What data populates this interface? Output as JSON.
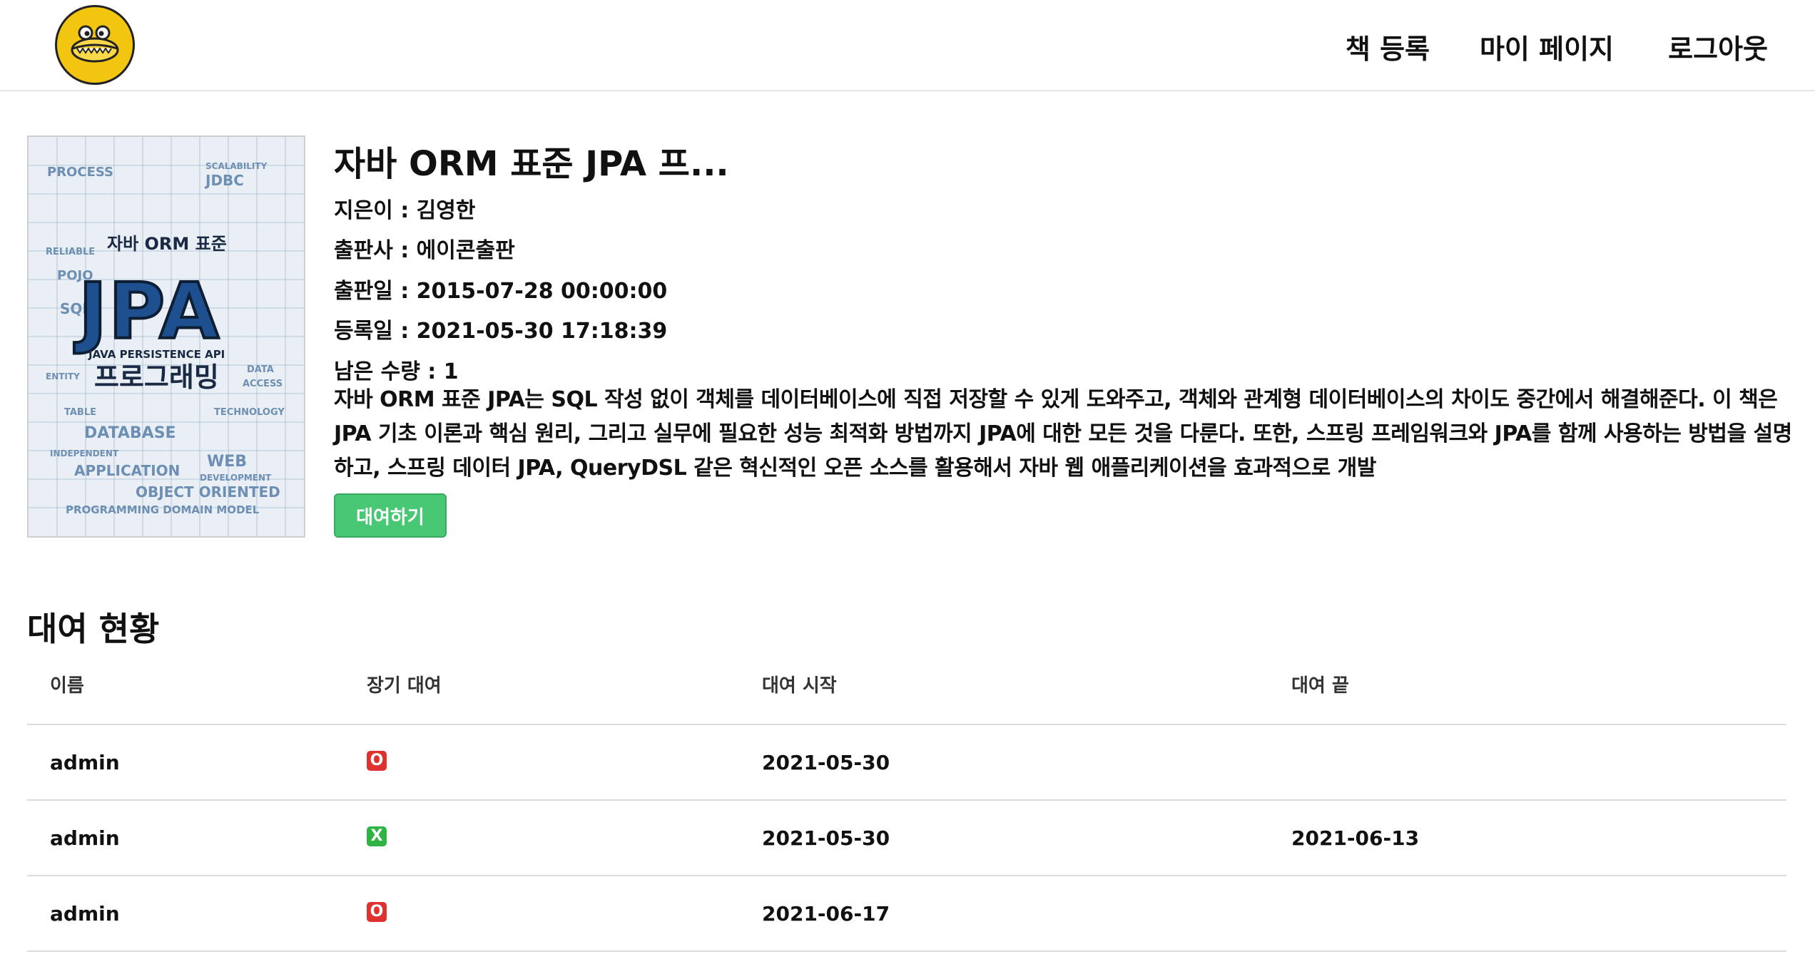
{
  "header": {
    "logo_alt": "logo",
    "nav": [
      {
        "label": "책 등록"
      },
      {
        "label": "마이 페이지"
      },
      {
        "label": "로그아웃"
      }
    ]
  },
  "book": {
    "title": "자바 ORM 표준 JPA 프...",
    "author": "지은이 : 김영한",
    "publisher": "출판사 : 에이콘출판",
    "published": "출판일 : 2015-07-28 00:00:00",
    "registered": "등록일 : 2021-05-30 17:18:39",
    "remaining": "남은 수량 : 1",
    "description": "자바 ORM 표준 JPA는 SQL 작성 없이 객체를 데이터베이스에 직접 저장할 수 있게 도와주고, 객체와 관계형 데이터베이스의 차이도 중간에서 해결해준다. 이 책은 JPA 기초 이론과 핵심 원리, 그리고 실무에 필요한 성능 최적화 방법까지 JPA에 대한 모든 것을 다룬다. 또한, 스프링 프레임워크와 JPA를 함께 사용하는 방법을 설명하고, 스프링 데이터 JPA, QueryDSL 같은 혁신적인 오픈 소스를 활용해서 자바 웹 애플리케이션을 효과적으로 개발",
    "rent_button": "대여하기",
    "cover": {
      "series": "PROGRAMMING",
      "main": "JPA",
      "subtitle": "자바 ORM 표준",
      "caption": "JAVA PERSISTENCE API",
      "korean": "프로그래밍",
      "words": [
        "PROCESS",
        "SCALABILITY",
        "JDBC",
        "RELIABLE",
        "POJO",
        "SQL",
        "ENTITY",
        "DATA ACCESS",
        "TABLE",
        "TECHNOLOGY",
        "DATABASE",
        "INDEPENDENT",
        "APPLICATION",
        "WEB DEVELOPMENT",
        "OBJECT ORIENTED",
        "PROGRAMMING DOMAIN MODEL"
      ]
    }
  },
  "rentals": {
    "title": "대여 현황",
    "columns": [
      "이름",
      "장기 대여",
      "대여 시작",
      "대여 끝"
    ],
    "rows": [
      {
        "name": "admin",
        "long_term": "O",
        "start": "2021-05-30",
        "end": ""
      },
      {
        "name": "admin",
        "long_term": "X",
        "start": "2021-05-30",
        "end": "2021-06-13"
      },
      {
        "name": "admin",
        "long_term": "O",
        "start": "2021-06-17",
        "end": ""
      }
    ]
  }
}
